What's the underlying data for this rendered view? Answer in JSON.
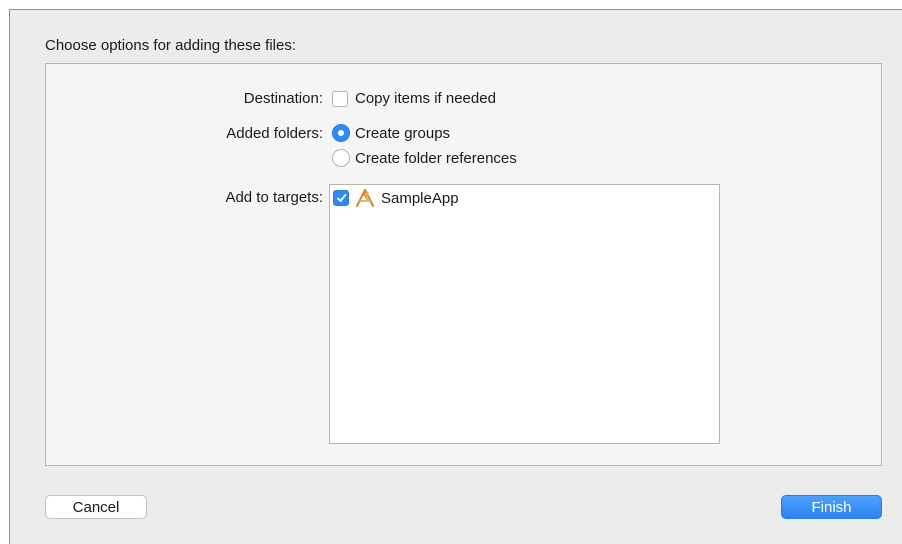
{
  "dialog": {
    "title": "Choose options for adding these files:"
  },
  "destination": {
    "label": "Destination:",
    "option_label": "Copy items if needed",
    "checked": false
  },
  "added_folders": {
    "label": "Added folders:",
    "options": [
      {
        "label": "Create groups",
        "selected": true
      },
      {
        "label": "Create folder references",
        "selected": false
      }
    ]
  },
  "targets": {
    "label": "Add to targets:",
    "items": [
      {
        "name": "SampleApp",
        "checked": true,
        "icon": "app-target-icon"
      }
    ]
  },
  "buttons": {
    "cancel_label": "Cancel",
    "finish_label": "Finish"
  },
  "colors": {
    "accent": "#2f8af5",
    "sheet_background": "#ececec",
    "panel_background": "#f5f5f5"
  }
}
